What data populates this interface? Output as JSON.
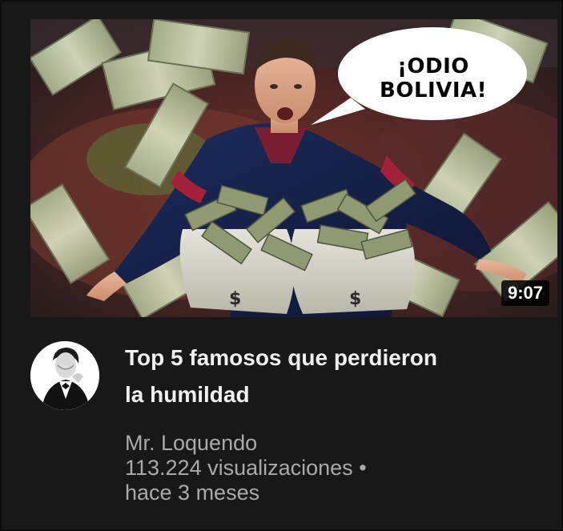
{
  "video": {
    "thumbnail": {
      "speech_bubble": {
        "line1": "¡ODIO",
        "line2": "BOLIVIA!"
      },
      "duration": "9:07"
    },
    "title": {
      "line1": "Top 5 famosos que perdieron",
      "line2": "la humildad"
    },
    "channel": "Mr. Loquendo",
    "views": "113.224 visualizaciones •",
    "age": "hace 3 meses"
  },
  "icons": {
    "avatar": "channel-avatar-tuxedo-man"
  },
  "colors": {
    "background": "#181818",
    "title_text": "#f1f1f1",
    "secondary_text": "#aaaaaa",
    "duration_badge": "#000000"
  }
}
